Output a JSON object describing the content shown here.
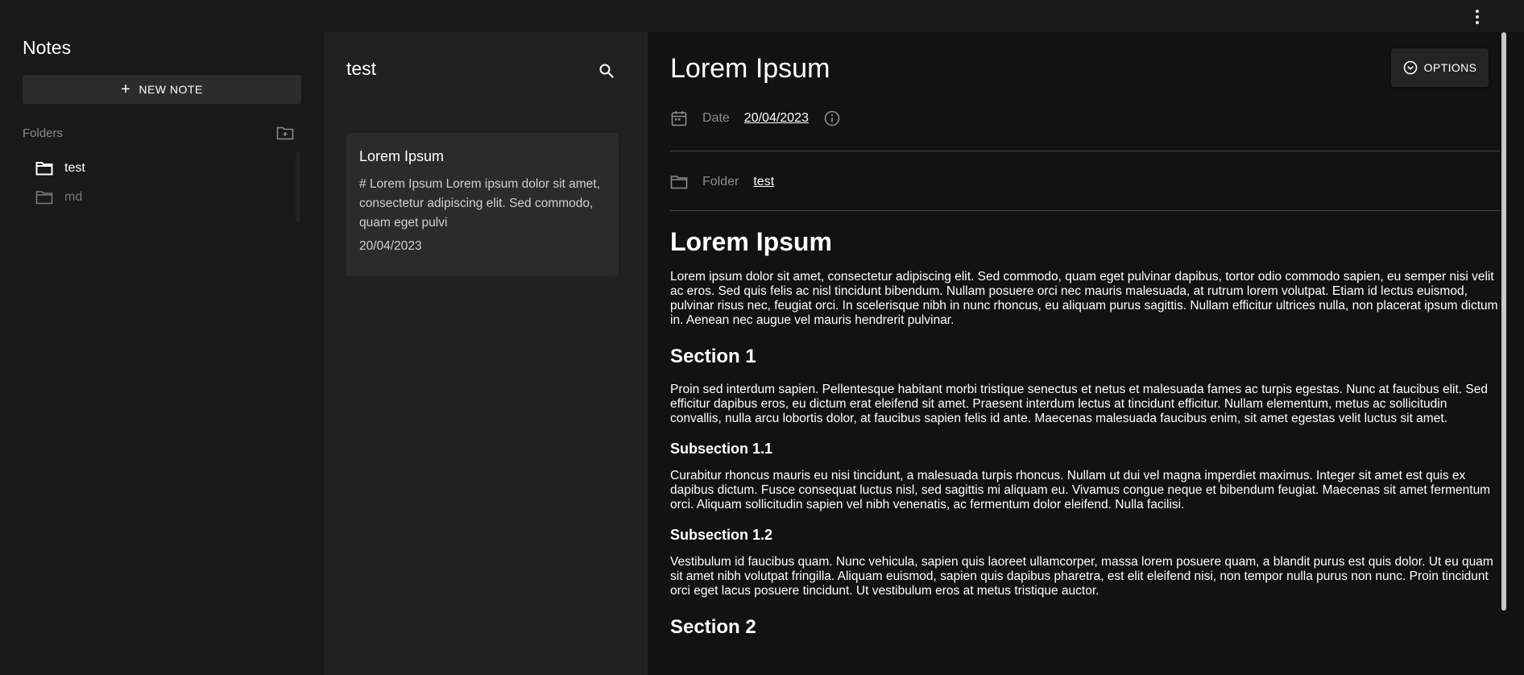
{
  "sidebar": {
    "title": "Notes",
    "new_note_label": "NEW NOTE",
    "folders_label": "Folders",
    "folders": [
      {
        "name": "test",
        "active": true
      },
      {
        "name": "md",
        "active": false
      }
    ]
  },
  "note_list": {
    "title": "test",
    "notes": [
      {
        "title": "Lorem Ipsum",
        "excerpt": "# Lorem Ipsum Lorem ipsum dolor sit amet, consectetur adipiscing elit. Sed commodo, quam eget pulvi",
        "date": "20/04/2023"
      }
    ]
  },
  "editor": {
    "title": "Lorem Ipsum",
    "options_label": "OPTIONS",
    "date_label": "Date",
    "date_value": "20/04/2023",
    "folder_label": "Folder",
    "folder_value": "test",
    "content": {
      "h1": "Lorem Ipsum",
      "p1": "Lorem ipsum dolor sit amet, consectetur adipiscing elit. Sed commodo, quam eget pulvinar dapibus, tortor odio commodo sapien, eu semper nisi velit ac eros. Sed quis felis ac nisl tincidunt bibendum. Nullam posuere orci nec mauris malesuada, at rutrum lorem volutpat. Etiam id lectus euismod, pulvinar risus nec, feugiat orci. In scelerisque nibh in nunc rhoncus, eu aliquam purus sagittis. Nullam efficitur ultrices nulla, non placerat ipsum dictum in. Aenean nec augue vel mauris hendrerit pulvinar.",
      "section1": "Section 1",
      "p2": "Proin sed interdum sapien. Pellentesque habitant morbi tristique senectus et netus et malesuada fames ac turpis egestas. Nunc at faucibus elit. Sed efficitur dapibus eros, eu dictum erat eleifend sit amet. Praesent interdum lectus at tincidunt efficitur. Nullam elementum, metus ac sollicitudin convallis, nulla arcu lobortis dolor, at faucibus sapien felis id ante. Maecenas malesuada faucibus enim, sit amet egestas velit luctus sit amet.",
      "subsection11": "Subsection 1.1",
      "p3": "Curabitur rhoncus mauris eu nisi tincidunt, a malesuada turpis rhoncus. Nullam ut dui vel magna imperdiet maximus. Integer sit amet est quis ex dapibus dictum. Fusce consequat luctus nisl, sed sagittis mi aliquam eu. Vivamus congue neque et bibendum feugiat. Maecenas sit amet fermentum orci. Aliquam sollicitudin sapien vel nibh venenatis, ac fermentum dolor eleifend. Nulla facilisi.",
      "subsection12": "Subsection 1.2",
      "p4": "Vestibulum id faucibus quam. Nunc vehicula, sapien quis laoreet ullamcorper, massa lorem posuere quam, a blandit purus est quis dolor. Ut eu quam sit amet nibh volutpat fringilla. Aliquam euismod, sapien quis dapibus pharetra, est elit eleifend nisi, non tempor nulla purus non nunc. Proin tincidunt orci eget lacus posuere tincidunt. Ut vestibulum eros at metus tristique auctor.",
      "section2": "Section 2"
    }
  },
  "colors": {
    "background": "#121212",
    "sidebar": "#191919",
    "list_pane": "#202020",
    "card": "#2b2b2b",
    "muted_text": "#8c8c8c"
  }
}
